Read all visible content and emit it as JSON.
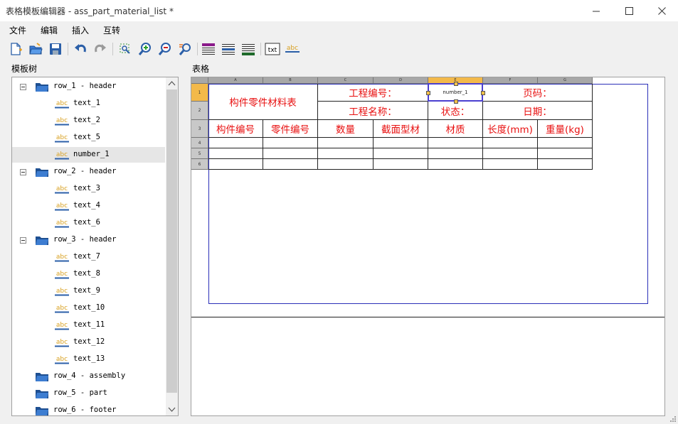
{
  "window": {
    "title": "表格模板编辑器 - ass_part_material_list *"
  },
  "menu": [
    "文件",
    "编辑",
    "插入",
    "互转"
  ],
  "toolbar": {
    "txt_label": "txt",
    "abc_label": "abc"
  },
  "tree_panel": {
    "label": "模板树"
  },
  "grid_panel": {
    "label": "表格"
  },
  "tree": [
    {
      "label": "row_1 - header",
      "type": "folder",
      "expanded": true
    },
    {
      "label": "text_1",
      "type": "text"
    },
    {
      "label": "text_2",
      "type": "text"
    },
    {
      "label": "text_5",
      "type": "text"
    },
    {
      "label": "number_1",
      "type": "text",
      "selected": true
    },
    {
      "label": "row_2 - header",
      "type": "folder",
      "expanded": true
    },
    {
      "label": "text_3",
      "type": "text"
    },
    {
      "label": "text_4",
      "type": "text"
    },
    {
      "label": "text_6",
      "type": "text"
    },
    {
      "label": "row_3 - header",
      "type": "folder",
      "expanded": true
    },
    {
      "label": "text_7",
      "type": "text"
    },
    {
      "label": "text_8",
      "type": "text"
    },
    {
      "label": "text_9",
      "type": "text"
    },
    {
      "label": "text_10",
      "type": "text"
    },
    {
      "label": "text_11",
      "type": "text"
    },
    {
      "label": "text_12",
      "type": "text"
    },
    {
      "label": "text_13",
      "type": "text"
    },
    {
      "label": "row_4 - assembly",
      "type": "folder",
      "expanded": false
    },
    {
      "label": "row_5 - part",
      "type": "folder",
      "expanded": false
    },
    {
      "label": "row_6 - footer",
      "type": "folder",
      "expanded": false
    }
  ],
  "grid": {
    "columns": [
      "A",
      "B",
      "C",
      "D",
      "E",
      "F",
      "G"
    ],
    "active_column": "E",
    "rows": [
      "1",
      "2",
      "3",
      "4",
      "5",
      "6"
    ],
    "active_row": "1",
    "cells": {
      "title": "构件零件材料表",
      "project_no": "工程编号：",
      "number_1": "number_1",
      "page_no": "页码：",
      "project_name": "工程名称：",
      "status": "状态：",
      "date": "日期：",
      "h_component_no": "构件编号",
      "h_part_no": "零件编号",
      "h_quantity": "数量",
      "h_section": "截面型材",
      "h_material": "材质",
      "h_length": "长度(mm)",
      "h_weight": "重量(kg)"
    },
    "colors": {
      "cell_text": "#e81010",
      "selection": "#4a3fd0",
      "active_header": "#f3b94a"
    }
  }
}
